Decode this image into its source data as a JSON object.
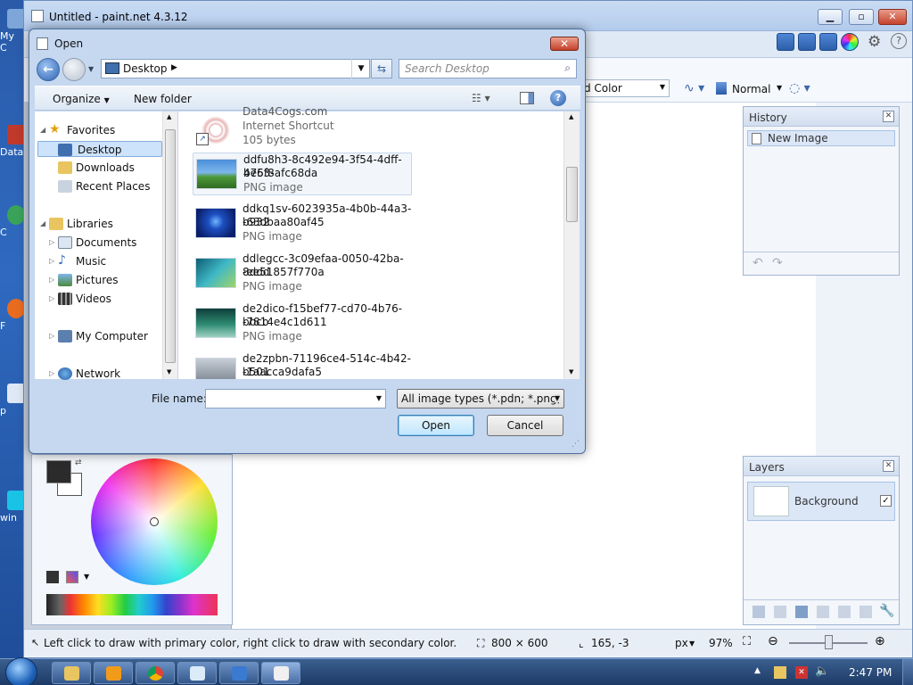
{
  "desktop": {
    "icons": [
      {
        "label": "My C"
      },
      {
        "label": "Data"
      },
      {
        "label": "C"
      },
      {
        "label": "F"
      },
      {
        "label": "p"
      },
      {
        "label": "win"
      }
    ]
  },
  "paintnet": {
    "title": "Untitled - paint.net 4.3.12",
    "options": {
      "fill_label": "d Color",
      "blend_mode": "Normal"
    },
    "history": {
      "title": "History",
      "items": [
        "New Image"
      ]
    },
    "layers": {
      "title": "Layers",
      "items": [
        {
          "name": "Background",
          "visible": true
        }
      ]
    },
    "status": {
      "hint": "Left click to draw with primary color, right click to draw with secondary color.",
      "image_size": "800 × 600",
      "cursor_pos": "165, -3",
      "units": "px",
      "zoom": "97%"
    }
  },
  "dialog": {
    "title": "Open",
    "address": "Desktop",
    "search_placeholder": "Search Desktop",
    "toolbar": {
      "organize": "Organize",
      "new_folder": "New folder"
    },
    "nav": {
      "favorites": "Favorites",
      "desktop": "Desktop",
      "downloads": "Downloads",
      "recent": "Recent Places",
      "libraries": "Libraries",
      "documents": "Documents",
      "music": "Music",
      "pictures": "Pictures",
      "videos": "Videos",
      "computer": "My Computer",
      "network": "Network"
    },
    "files": [
      {
        "name1": "Data4Cogs.com",
        "name2": "",
        "type": "Internet Shortcut",
        "size": "105 bytes"
      },
      {
        "name1": "ddfu8h3-8c492e94-3f54-4dff-be63-",
        "name2": "475f8afc68da",
        "type": "PNG image"
      },
      {
        "name1": "ddkq1sv-6023935a-4b0b-44a3-b932",
        "name2": "-63dbaa80af45",
        "type": "PNG image"
      },
      {
        "name1": "ddlegcc-3c09efaa-0050-42ba-8ddd",
        "name2": "-ee51857f770a",
        "type": "PNG image"
      },
      {
        "name1": "de2dico-f15bef77-cd70-4b76-bbcb",
        "name2": "-7814e4c1d611",
        "type": "PNG image"
      },
      {
        "name1": "de2zpbn-71196ce4-514c-4b42-b501",
        "name2": "-1aacca9dafa5",
        "type": ""
      }
    ],
    "filename_label": "File name:",
    "filename_value": "",
    "filter": "All image types (*.pdn; *.png; *",
    "open_button": "Open",
    "cancel_button": "Cancel"
  },
  "taskbar": {
    "clock": "2:47 PM"
  }
}
